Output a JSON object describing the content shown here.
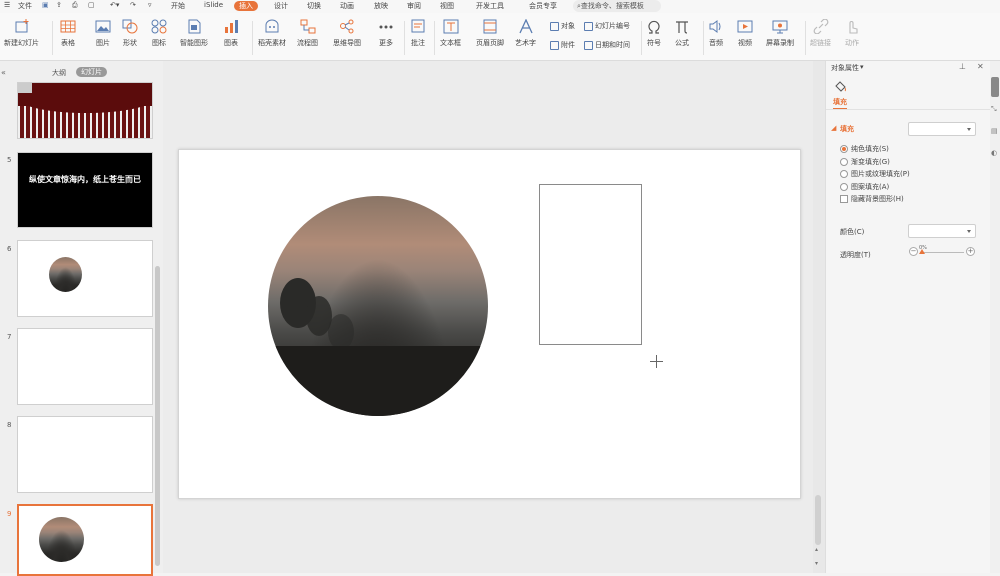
{
  "menu": {
    "file": "文件",
    "tabs": [
      "开始",
      "iSlide",
      "插入",
      "设计",
      "切换",
      "动画",
      "放映",
      "审阅",
      "视图",
      "开发工具",
      "会员专享"
    ],
    "active_tab": "插入",
    "search_placeholder": "查找命令、搜索模板"
  },
  "ribbon": {
    "new_slide": "新建幻灯片",
    "table": "表格",
    "picture": "图片",
    "shape": "形状",
    "icon": "图标",
    "smartart": "智能图形",
    "chart": "图表",
    "material": "稻壳素材",
    "flowchart": "流程图",
    "mindmap": "思维导图",
    "more": "更多",
    "comment": "批注",
    "textbox": "文本框",
    "header_footer": "页眉页脚",
    "wordart": "艺术字",
    "object": "对象",
    "attachment": "附件",
    "slide_number": "幻灯片编号",
    "datetime": "日期和时间",
    "symbol": "符号",
    "formula": "公式",
    "audio": "音频",
    "video": "视频",
    "screen_record": "屏幕录制",
    "hyperlink": "超链接",
    "action": "动作"
  },
  "left_panel": {
    "tab_outline": "大纲",
    "tab_slides": "幻灯片",
    "slides": [
      {
        "number": "5",
        "text": "纵使文章惊海内，纸上苍生而已"
      },
      {
        "number": "6",
        "text": ""
      },
      {
        "number": "7",
        "text": ""
      },
      {
        "number": "8",
        "text": ""
      },
      {
        "number": "9",
        "text": ""
      }
    ]
  },
  "pane": {
    "title": "对象属性",
    "tab_fill": "填充",
    "section_fill": "填充",
    "options": [
      {
        "label": "纯色填充(S)",
        "selected": true
      },
      {
        "label": "渐变填充(G)",
        "selected": false
      },
      {
        "label": "图片或纹理填充(P)",
        "selected": false
      },
      {
        "label": "图案填充(A)",
        "selected": false
      }
    ],
    "hide_bg": "隐藏背景图形(H)",
    "color_label": "颜色(C)",
    "transparency_label": "透明度(T)",
    "transparency_value": "0%"
  },
  "colors": {
    "accent": "#e8743b"
  }
}
